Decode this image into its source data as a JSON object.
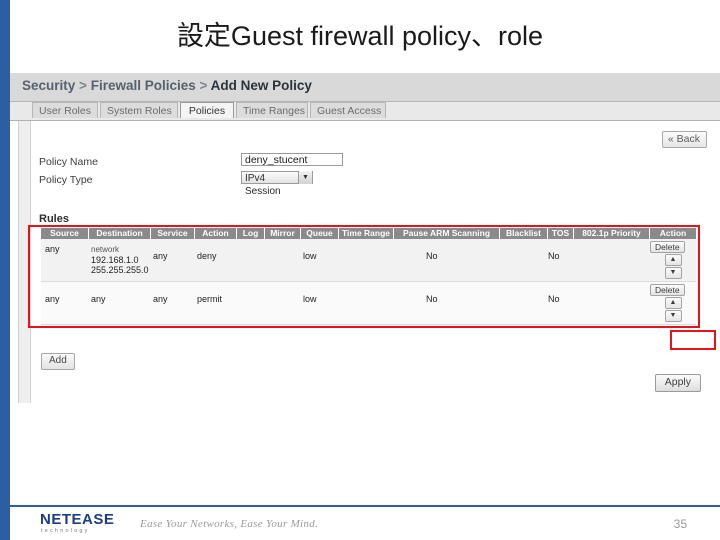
{
  "slide": {
    "title": "設定Guest firewall policy、role",
    "page_number": "35",
    "accent_color": "#2a5fa5",
    "highlight_color": "#e8131a"
  },
  "screenshot": {
    "breadcrumb": {
      "root": "Security",
      "sep": ">",
      "level2": "Firewall Policies",
      "current": "Add New Policy"
    },
    "tabs": [
      {
        "label": "User Roles",
        "active": false
      },
      {
        "label": "System Roles",
        "active": false
      },
      {
        "label": "Policies",
        "active": true
      },
      {
        "label": "Time Ranges",
        "active": false
      },
      {
        "label": "Guest Access",
        "active": false
      }
    ],
    "back_button": "« Back",
    "form": {
      "policy_name_label": "Policy Name",
      "policy_name_value": "deny_stucent",
      "policy_type_label": "Policy Type",
      "policy_type_value": "IPv4 Session",
      "policy_type_arrow": "▼"
    },
    "rules_label": "Rules",
    "rules_table": {
      "columns": [
        "Source",
        "Destination",
        "Service",
        "Action",
        "Log",
        "Mirror",
        "Queue",
        "Time Range",
        "Pause ARM Scanning",
        "Blacklist",
        "TOS",
        "802.1p Priority",
        "Action"
      ],
      "rows": [
        {
          "source": "any",
          "destination_label": "network",
          "destination_lines": [
            "192.168.1.0",
            "255.255.255.0"
          ],
          "service": "any",
          "action": "deny",
          "log": "",
          "mirror": "",
          "queue": "low",
          "time_range": "",
          "pause_arm": "No",
          "blacklist": "",
          "tos": "No",
          "priority": "",
          "row_buttons": {
            "delete": "Delete",
            "up": "▲",
            "down": "▼"
          }
        },
        {
          "source": "any",
          "destination_label": "",
          "destination_lines": [
            "any"
          ],
          "service": "any",
          "action": "permit",
          "log": "",
          "mirror": "",
          "queue": "low",
          "time_range": "",
          "pause_arm": "No",
          "blacklist": "",
          "tos": "No",
          "priority": "",
          "row_buttons": {
            "delete": "Delete",
            "up": "▲",
            "down": "▼"
          }
        }
      ]
    },
    "add_button": "Add",
    "apply_button": "Apply"
  },
  "footer": {
    "logo_main": "NETEASE",
    "logo_sub": "technology",
    "tagline": "Ease Your Networks, Ease Your Mind."
  }
}
